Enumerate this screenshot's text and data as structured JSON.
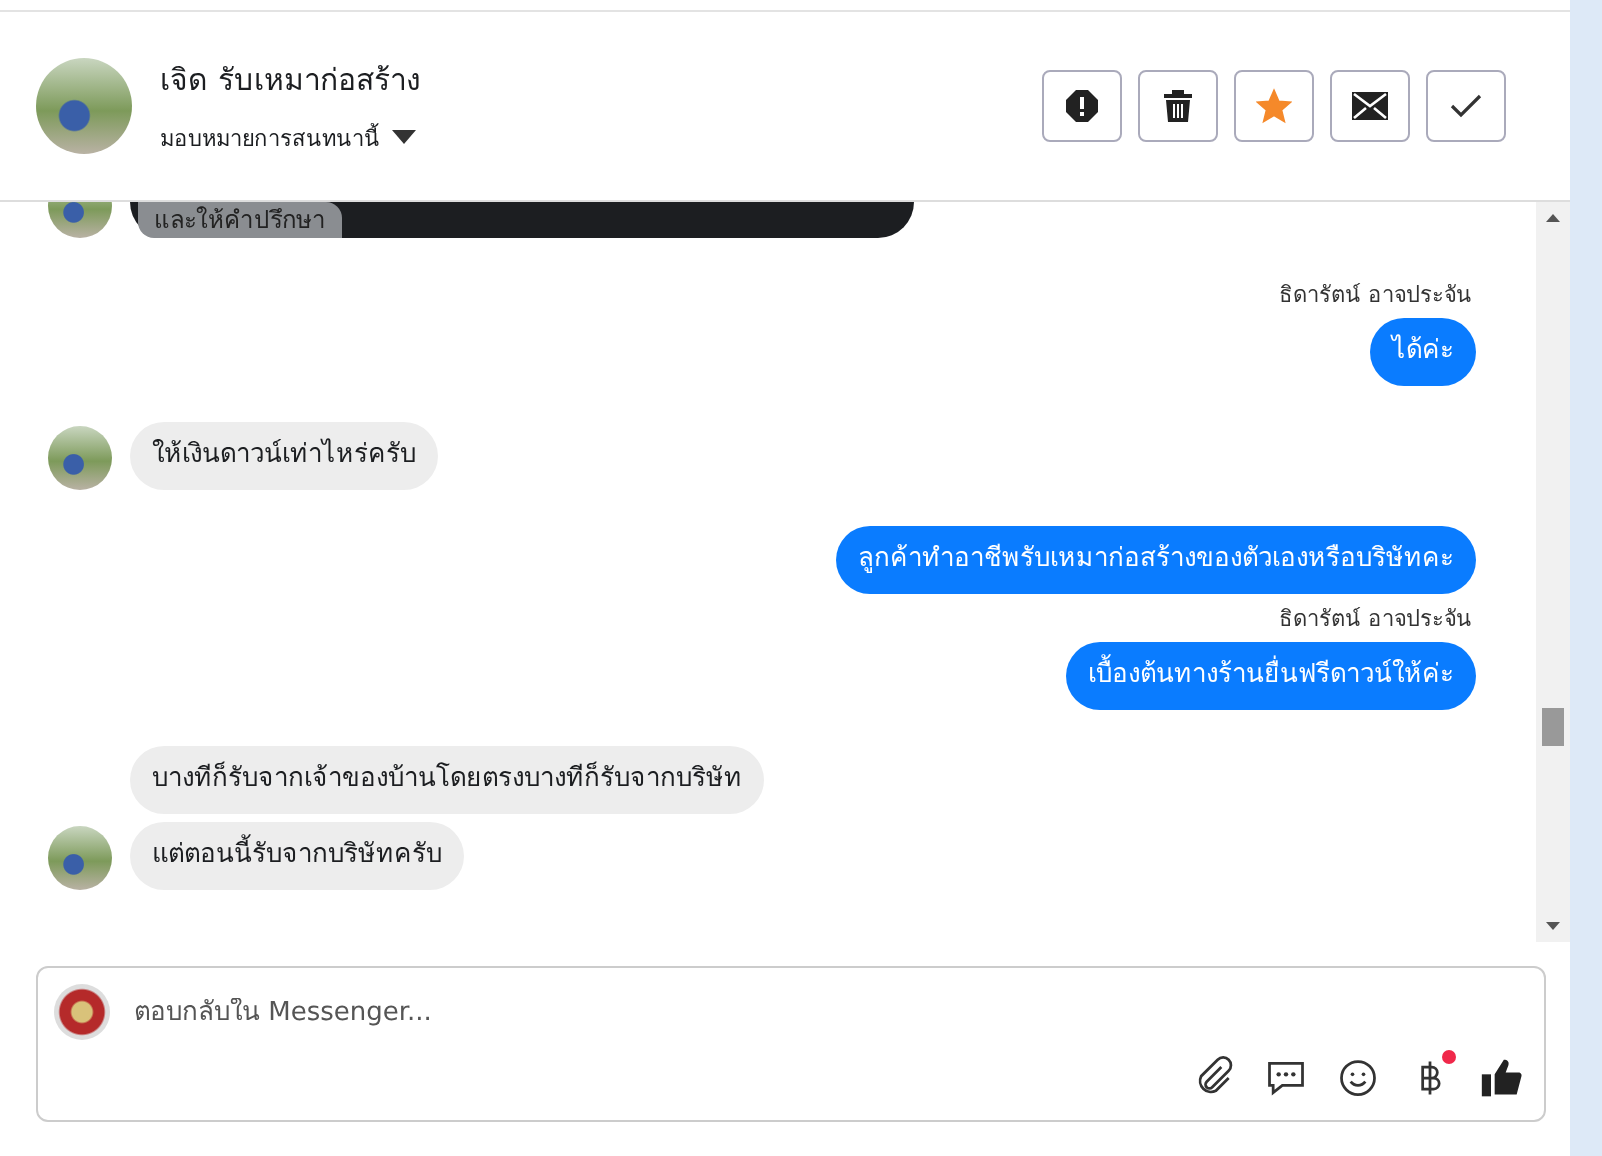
{
  "header": {
    "name": "เจิด รับเหมาก่อสร้าง",
    "assign": "มอบหมายการสนทนานี้",
    "actions": [
      {
        "kind": "spam"
      },
      {
        "kind": "delete"
      },
      {
        "kind": "star",
        "selected": true
      },
      {
        "kind": "unread"
      },
      {
        "kind": "done"
      }
    ]
  },
  "messages": [
    {
      "kind": "card",
      "text": "และให้คำปรึกษา",
      "avatar": true
    },
    {
      "kind": "sender",
      "text": "ธิดารัตน์ อาจประจัน"
    },
    {
      "kind": "out",
      "text": "ได้ค่ะ"
    },
    {
      "kind": "in",
      "text": "ให้เงินดาวน์เท่าไหร่ครับ",
      "avatar": true
    },
    {
      "kind": "out",
      "text": "ลูกค้าทำอาชีพรับเหมาก่อสร้างของตัวเองหรือบริษัทคะ"
    },
    {
      "kind": "sender",
      "text": "ธิดารัตน์ อาจประจัน"
    },
    {
      "kind": "out",
      "text": "เบื้องต้นทางร้านยื่นฟรีดาวน์ให้ค่ะ"
    },
    {
      "kind": "in",
      "text": "บางทีก็รับจากเจ้าของบ้านโดยตรงบางทีก็รับจากบริษัท",
      "avatar": false
    },
    {
      "kind": "in",
      "text": "แต่ตอนนี้รับจากบริษัทครับ",
      "avatar": true
    }
  ],
  "composer": {
    "placeholder": "ตอบกลับใน Messenger...",
    "tools": [
      {
        "kind": "attach"
      },
      {
        "kind": "saved-reply"
      },
      {
        "kind": "emoji"
      },
      {
        "kind": "baht",
        "badge": true
      },
      {
        "kind": "like"
      }
    ]
  }
}
